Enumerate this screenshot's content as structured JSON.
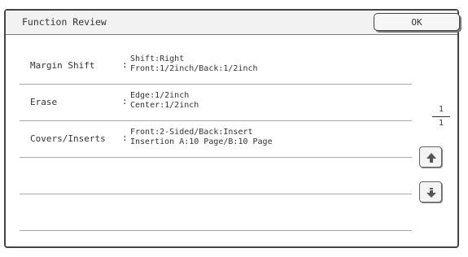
{
  "dialog": {
    "title": "Function Review",
    "ok_label": "OK"
  },
  "items": [
    {
      "name": "Margin Shift",
      "values": [
        "Shift:Right",
        "Front:1/2inch/Back:1/2inch"
      ]
    },
    {
      "name": "Erase",
      "values": [
        "Edge:1/2inch",
        "Center:1/2inch"
      ]
    },
    {
      "name": "Covers/Inserts",
      "values": [
        "Front:2-Sided/Back:Insert",
        "Insertion A:10 Page/B:10 Page"
      ]
    },
    {
      "name": "",
      "values": [
        "",
        ""
      ]
    },
    {
      "name": "",
      "values": [
        "",
        ""
      ]
    }
  ],
  "pager": {
    "current": "1",
    "total": "1"
  },
  "icons": {
    "scroll_up": "arrow-up-icon",
    "scroll_down": "arrow-down-icon"
  }
}
